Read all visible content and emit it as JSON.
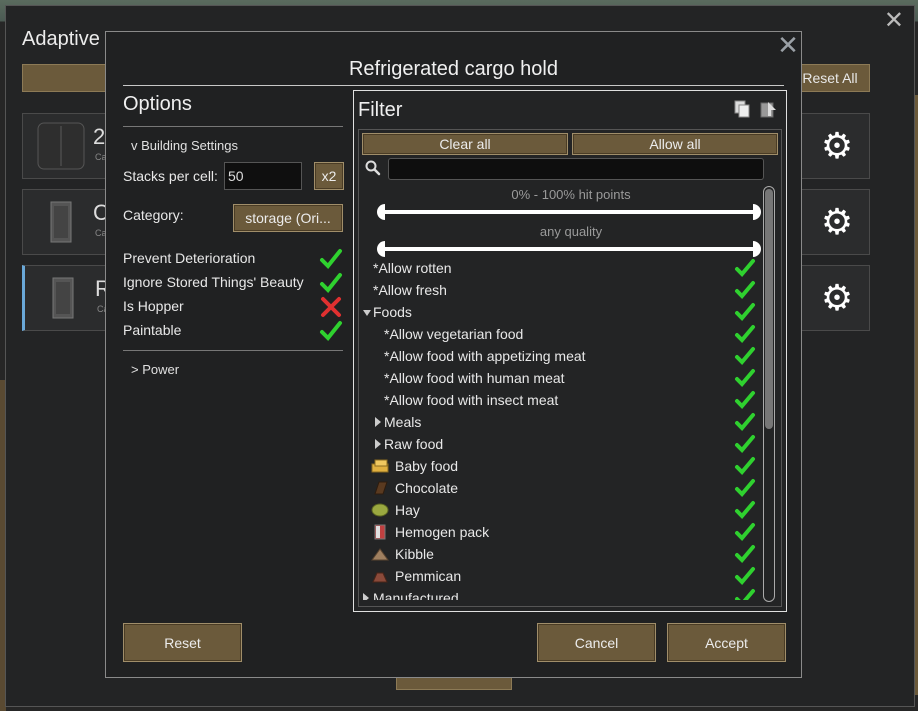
{
  "background_window": {
    "title": "Adaptive",
    "reset_all_label": "Reset All",
    "rows": [
      {
        "name": "2",
        "sub": "Ca"
      },
      {
        "name": "C",
        "sub": "Ca"
      },
      {
        "name": "R",
        "sub": "Ca"
      }
    ]
  },
  "dialog": {
    "title": "Refrigerated cargo hold",
    "options": {
      "heading": "Options",
      "building_settings": "v Building Settings",
      "stacks_label": "Stacks per cell:",
      "stacks_value": "50",
      "x2_label": "x2",
      "category_label": "Category:",
      "category_value": "storage (Ori...",
      "toggles": [
        {
          "label": "Prevent Deterioration",
          "state": "check"
        },
        {
          "label": "Ignore Stored Things' Beauty",
          "state": "check"
        },
        {
          "label": "Is Hopper",
          "state": "cross"
        },
        {
          "label": "Paintable",
          "state": "check"
        }
      ],
      "power": "> Power"
    },
    "filter": {
      "title": "Filter",
      "clear_all": "Clear all",
      "allow_all": "Allow all",
      "search_value": "",
      "hitpoints_label": "0% - 100% hit points",
      "quality_label": "any quality",
      "items": [
        {
          "label": "*Allow rotten",
          "indent": 0,
          "arrow": "none",
          "icon": "",
          "checked": true
        },
        {
          "label": "*Allow fresh",
          "indent": 0,
          "arrow": "none",
          "icon": "",
          "checked": true
        },
        {
          "label": "Foods",
          "indent": 0,
          "arrow": "down",
          "icon": "",
          "checked": true
        },
        {
          "label": "*Allow vegetarian food",
          "indent": 1,
          "arrow": "none",
          "icon": "",
          "checked": true
        },
        {
          "label": "*Allow food with appetizing meat",
          "indent": 1,
          "arrow": "none",
          "icon": "",
          "checked": true
        },
        {
          "label": "*Allow food with human meat",
          "indent": 1,
          "arrow": "none",
          "icon": "",
          "checked": true
        },
        {
          "label": "*Allow food with insect meat",
          "indent": 1,
          "arrow": "none",
          "icon": "",
          "checked": true
        },
        {
          "label": "Meals",
          "indent": 1,
          "arrow": "right",
          "icon": "",
          "checked": true
        },
        {
          "label": "Raw food",
          "indent": 1,
          "arrow": "right",
          "icon": "",
          "checked": true
        },
        {
          "label": "Baby food",
          "indent": 2,
          "arrow": "none",
          "icon": "baby-food-icon",
          "checked": true
        },
        {
          "label": "Chocolate",
          "indent": 2,
          "arrow": "none",
          "icon": "chocolate-icon",
          "checked": true
        },
        {
          "label": "Hay",
          "indent": 2,
          "arrow": "none",
          "icon": "hay-icon",
          "checked": true
        },
        {
          "label": "Hemogen pack",
          "indent": 2,
          "arrow": "none",
          "icon": "hemogen-pack-icon",
          "checked": true
        },
        {
          "label": "Kibble",
          "indent": 2,
          "arrow": "none",
          "icon": "kibble-icon",
          "checked": true
        },
        {
          "label": "Pemmican",
          "indent": 2,
          "arrow": "none",
          "icon": "pemmican-icon",
          "checked": true
        },
        {
          "label": "Manufactured",
          "indent": 0,
          "arrow": "right",
          "icon": "",
          "checked": true
        }
      ]
    },
    "buttons": {
      "reset": "Reset",
      "cancel": "Cancel",
      "accept": "Accept"
    }
  },
  "colors": {
    "check": "#2fd12f",
    "cross": "#e03030",
    "button": "#6b5a3b"
  }
}
